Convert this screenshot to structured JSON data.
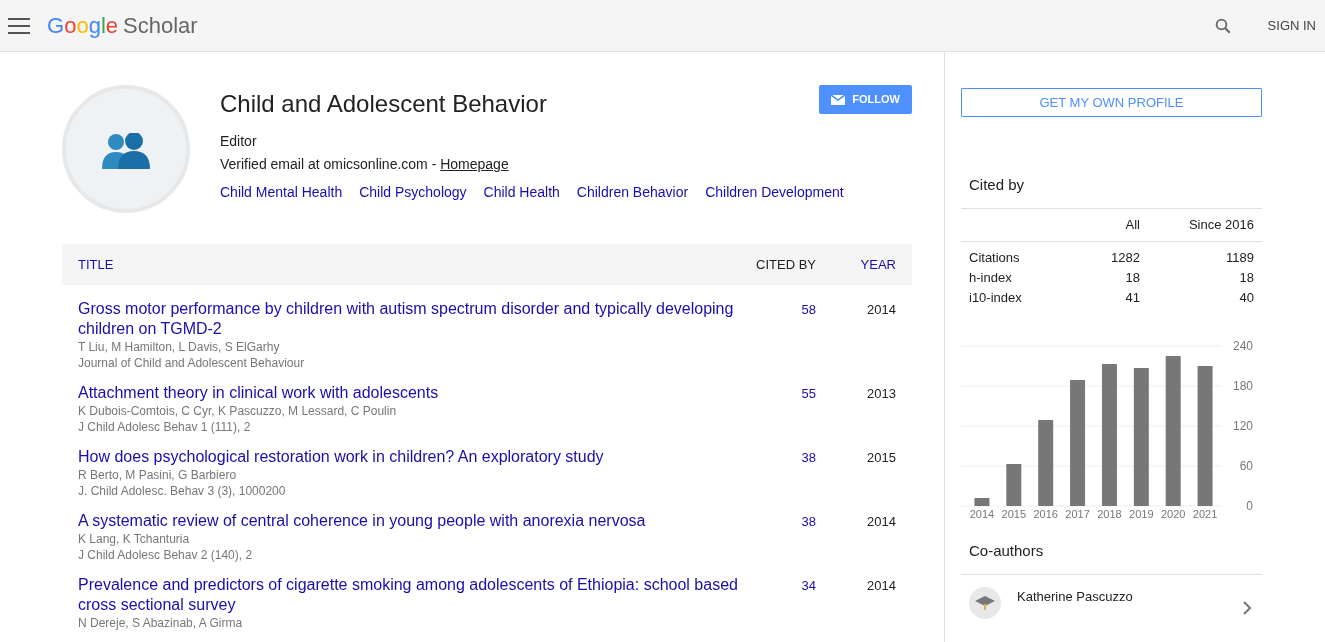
{
  "header": {
    "logo_google": "Google",
    "logo_scholar": "Scholar",
    "sign_in": "SIGN IN"
  },
  "profile": {
    "name": "Child and Adolescent Behavior",
    "affiliation": "Editor",
    "email": "Verified email at omicsonline.com - ",
    "homepage": "Homepage",
    "interests": [
      "Child Mental Health",
      "Child Psychology",
      "Child Health",
      "Children Behavior",
      "Children Development"
    ],
    "follow": "FOLLOW"
  },
  "table": {
    "columns": [
      "TITLE",
      "CITED BY",
      "YEAR"
    ],
    "rows": [
      {
        "title": "Gross motor performance by children with autism spectrum disorder and typically developing children on TGMD-2",
        "authors": "T Liu, M Hamilton, L Davis, S ElGarhy",
        "venue": "Journal of Child and Adolescent Behaviour",
        "cited_by": "58",
        "year": "2014"
      },
      {
        "title": "Attachment theory in clinical work with adolescents",
        "authors": "K Dubois-Comtois, C Cyr, K Pascuzzo, M Lessard, C Poulin",
        "venue": "J Child Adolesc Behav 1 (111), 2",
        "cited_by": "55",
        "year": "2013"
      },
      {
        "title": "How does psychological restoration work in children? An exploratory study",
        "authors": "R Berto, M Pasini, G Barbiero",
        "venue": "J. Child Adolesc. Behav 3 (3), 1000200",
        "cited_by": "38",
        "year": "2015"
      },
      {
        "title": "A systematic review of central coherence in young people with anorexia nervosa",
        "authors": "K Lang, K Tchanturia",
        "venue": "J Child Adolesc Behav 2 (140), 2",
        "cited_by": "38",
        "year": "2014"
      },
      {
        "title": "Prevalence and predictors of cigarette smoking among adolescents of Ethiopia: school based cross sectional survey",
        "authors": "N Dereje, S Abazinab, A Girma",
        "cited_by": "34",
        "year": "2014"
      }
    ]
  },
  "sidebar": {
    "get_profile": "GET MY OWN PROFILE",
    "cited_by_title": "Cited by",
    "stats_columns": [
      "All",
      "Since 2016"
    ],
    "stats": [
      {
        "label": "Citations",
        "all": "1282",
        "since": "1189"
      },
      {
        "label": "h-index",
        "all": "18",
        "since": "18"
      },
      {
        "label": "i10-index",
        "all": "41",
        "since": "40"
      }
    ],
    "chart_data": {
      "type": "bar",
      "categories": [
        "2014",
        "2015",
        "2016",
        "2017",
        "2018",
        "2019",
        "2020",
        "2021"
      ],
      "values": [
        12,
        63,
        129,
        189,
        213,
        207,
        225,
        210
      ],
      "ylim": [
        0,
        240
      ],
      "yticks": [
        0,
        60,
        120,
        180,
        240
      ],
      "grid": true
    },
    "coauthors_title": "Co-authors",
    "coauthors": [
      {
        "name": "Katherine Pascuzzo"
      }
    ]
  }
}
